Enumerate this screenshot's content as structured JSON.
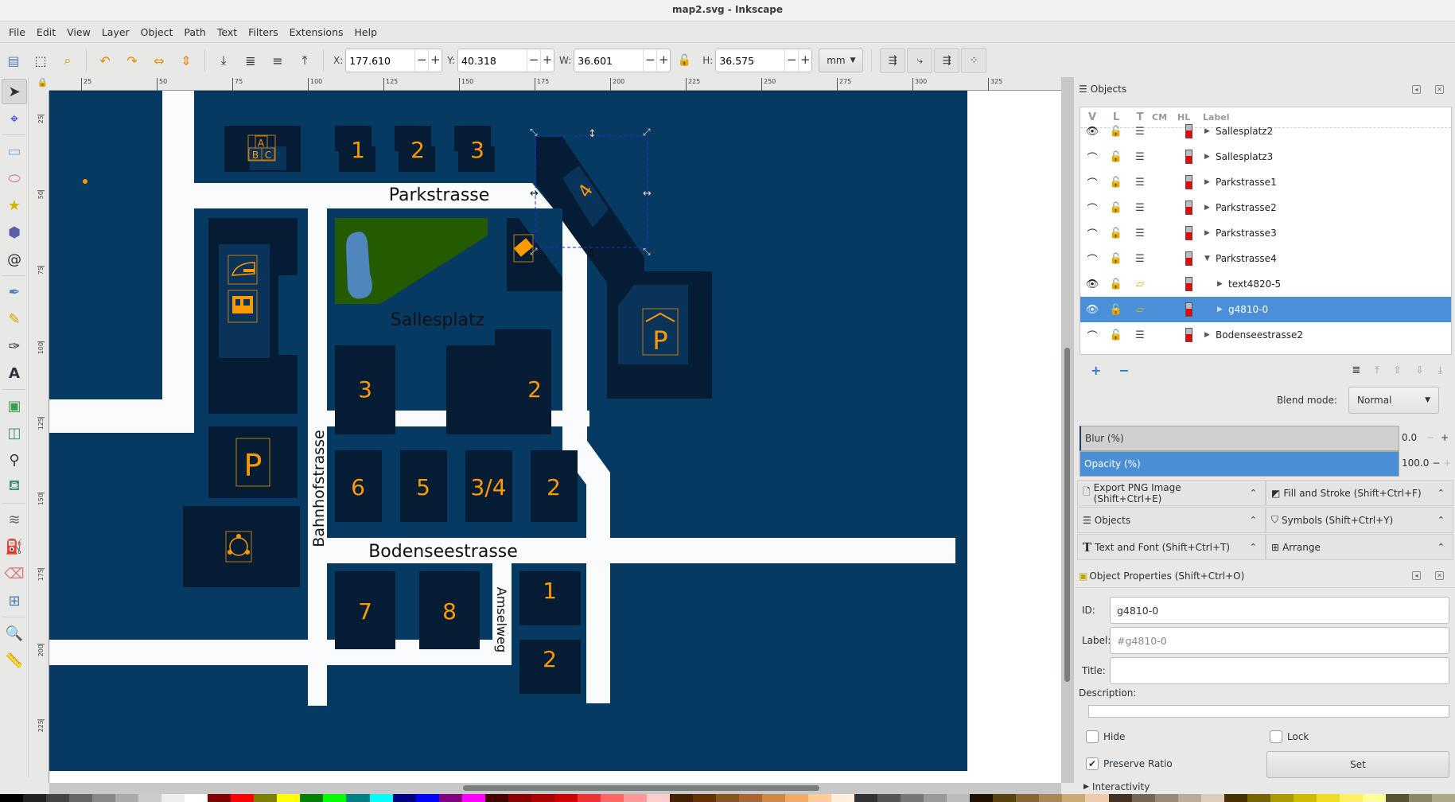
{
  "window": {
    "title": "map2.svg - Inkscape"
  },
  "menu": [
    "File",
    "Edit",
    "View",
    "Layer",
    "Object",
    "Path",
    "Text",
    "Filters",
    "Extensions",
    "Help"
  ],
  "toolbar": {
    "x_label": "X:",
    "x_value": "177.610",
    "y_label": "Y:",
    "y_value": "40.318",
    "w_label": "W:",
    "w_value": "36.601",
    "h_label": "H:",
    "h_value": "36.575",
    "unit": "mm",
    "minus": "−",
    "plus": "+"
  },
  "ruler": {
    "h_ticks": [
      "25",
      "50",
      "75",
      "100",
      "125",
      "150",
      "175",
      "200",
      "225",
      "250",
      "275",
      "300",
      "325"
    ],
    "v_ticks": [
      "25",
      "50",
      "75",
      "100",
      "125",
      "150",
      "175",
      "200",
      "225"
    ]
  },
  "map": {
    "streets": [
      "Parkstrasse",
      "Sallesplatz",
      "Bahnhofstrasse",
      "Bodenseestrasse",
      "Amselweg"
    ],
    "buildings_top": [
      "1",
      "2",
      "3"
    ],
    "diag_building": "4",
    "abc_sign": [
      "A",
      "B",
      "C"
    ],
    "sallesplatz_buildings": [
      "3",
      "2"
    ],
    "row_buildings": [
      "6",
      "5",
      "3/4",
      "2"
    ],
    "lower_buildings": [
      "7",
      "8"
    ],
    "amsel_buildings": [
      "1",
      "2"
    ],
    "parking": "P",
    "parking_garage": "P",
    "colors": {
      "bg": "#063a63",
      "building": "#041d35",
      "inner": "#0a3359",
      "street": "#f9fbfc",
      "park": "#245a00",
      "water": "#4f86bd",
      "accent": "#ff9900"
    }
  },
  "objects_panel": {
    "title": "Objects",
    "columns": [
      "V",
      "L",
      "T",
      "CM",
      "HL",
      "Label"
    ],
    "rows": [
      {
        "label": "Sallesplatz2",
        "visible": true,
        "level": 0,
        "expander": "collapsed",
        "selected": false
      },
      {
        "label": "Sallesplatz3",
        "visible": false,
        "level": 0,
        "expander": "collapsed",
        "selected": false
      },
      {
        "label": "Parkstrasse1",
        "visible": false,
        "level": 0,
        "expander": "collapsed",
        "selected": false
      },
      {
        "label": "Parkstrasse2",
        "visible": false,
        "level": 0,
        "expander": "collapsed",
        "selected": false
      },
      {
        "label": "Parkstrasse3",
        "visible": false,
        "level": 0,
        "expander": "collapsed",
        "selected": false
      },
      {
        "label": "Parkstrasse4",
        "visible": false,
        "level": 0,
        "expander": "expanded",
        "selected": false
      },
      {
        "label": "text4820-5",
        "visible": true,
        "level": 1,
        "expander": "collapsed",
        "selected": false
      },
      {
        "label": "g4810-0",
        "visible": true,
        "level": 1,
        "expander": "collapsed",
        "selected": true
      },
      {
        "label": "Bodenseestrasse2",
        "visible": false,
        "level": 0,
        "expander": "collapsed",
        "selected": false
      }
    ],
    "blend_label": "Blend mode:",
    "blend_value": "Normal",
    "blur_label": "Blur (%)",
    "blur_value": "0.0",
    "opacity_label": "Opacity (%)",
    "opacity_value": "100.0"
  },
  "docked": [
    {
      "label": "Export PNG Image (Shift+Ctrl+E)",
      "icon": "export-icon"
    },
    {
      "label": "Fill and Stroke (Shift+Ctrl+F)",
      "icon": "fill-stroke-icon"
    },
    {
      "label": "Objects",
      "icon": "objects-icon"
    },
    {
      "label": "Symbols (Shift+Ctrl+Y)",
      "icon": "symbols-icon"
    },
    {
      "label": "Text and Font (Shift+Ctrl+T)",
      "icon": "text-font-icon"
    },
    {
      "label": "Arrange",
      "icon": "arrange-icon"
    }
  ],
  "properties": {
    "title": "Object Properties (Shift+Ctrl+O)",
    "id_label": "ID:",
    "id_value": "g4810-0",
    "label_label": "Label:",
    "label_placeholder": "#g4810-0",
    "title_label": "Title:",
    "title_value": "",
    "desc_label": "Description:",
    "desc_value": "",
    "hide_label": "Hide",
    "hide_checked": false,
    "lock_label": "Lock",
    "lock_checked": false,
    "ratio_label": "Preserve Ratio",
    "ratio_checked": true,
    "set_label": "Set",
    "interactivity_label": "Interactivity"
  }
}
